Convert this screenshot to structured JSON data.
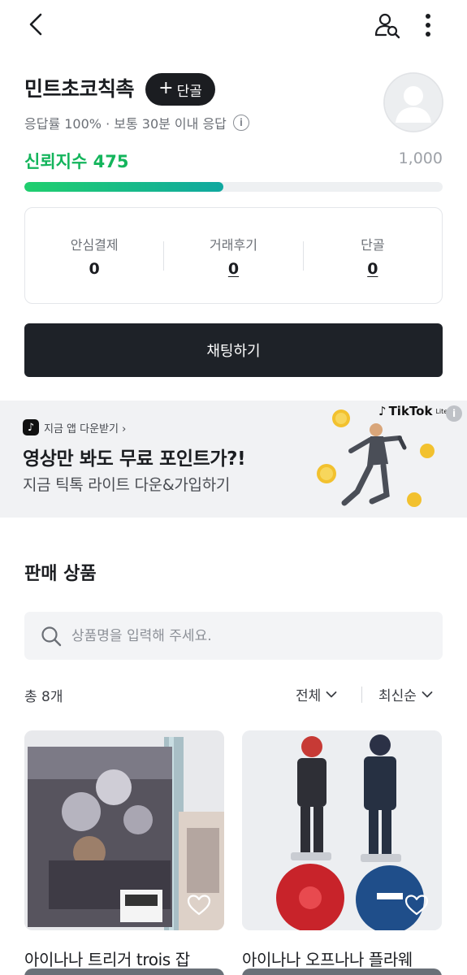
{
  "header": {
    "back_icon": "chevron-left-icon",
    "user_search_icon": "user-search-icon",
    "more_icon": "more-vertical-icon"
  },
  "profile": {
    "shop_name": "민트초코칙촉",
    "regular_button": "단골",
    "response_info": "응답률 100% · 보통 30분 이내 응답",
    "trust_label": "신뢰지수 475",
    "trust_value": 475,
    "trust_max": "1,000"
  },
  "stats": [
    {
      "label": "안심결제",
      "value": "0"
    },
    {
      "label": "거래후기",
      "value": "0"
    },
    {
      "label": "단골",
      "value": "0"
    }
  ],
  "chat_button": "채팅하기",
  "ad": {
    "download_text": "지금 앱 다운받기 ›",
    "headline": "영상만 봐도 무료 포인트가?!",
    "sub": "지금 틱톡 라이트 다운&가입하기",
    "brand": "TikTok",
    "brand_suffix": "Lite"
  },
  "products_section": {
    "title": "판매 상품",
    "search_placeholder": "상품명을 입력해 주세요.",
    "count": "총 8개",
    "filter": "전체",
    "sort": "최신순"
  },
  "products": [
    {
      "title": "아이나나 트리거 trois 잡"
    },
    {
      "title": "아이나나 오프나나 플라웨"
    }
  ],
  "colors": {
    "accent_green": "#14b55c",
    "dark_button": "#1e2228"
  }
}
